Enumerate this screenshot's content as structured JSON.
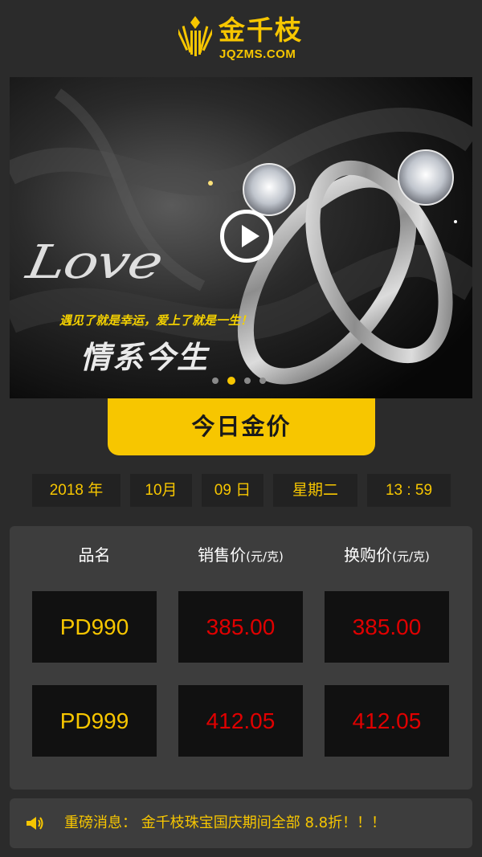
{
  "header": {
    "logo_cn": "金千枝",
    "logo_en": "JQZMS.COM",
    "logo_icon": "gold-leaf-icon"
  },
  "banner": {
    "script_text": "Love",
    "tagline": "遇见了就是幸运，爱上了就是一生！",
    "title": "情系今生",
    "play_icon": "play-icon",
    "dots": {
      "count": 4,
      "active_index": 1
    }
  },
  "gold_tab": {
    "label": "今日金价"
  },
  "date": {
    "year": "2018 年",
    "month": "10月",
    "day": "09 日",
    "weekday": "星期二",
    "time": "13 : 59"
  },
  "price_table": {
    "headers": {
      "name": "品名",
      "sell": "销售价",
      "sell_unit": "(元/克)",
      "exchange": "换购价",
      "exchange_unit": "(元/克)"
    },
    "rows": [
      {
        "name": "PD990",
        "sell": "385.00",
        "exchange": "385.00"
      },
      {
        "name": "PD999",
        "sell": "412.05",
        "exchange": "412.05"
      }
    ]
  },
  "notice": {
    "icon": "speaker-icon",
    "text": "重磅消息：  金千枝珠宝国庆期间全部 8.8折！！！"
  },
  "colors": {
    "accent": "#f7c600",
    "price_red": "#e00000",
    "background": "#2b2b2b",
    "panel": "#3d3d3d"
  }
}
